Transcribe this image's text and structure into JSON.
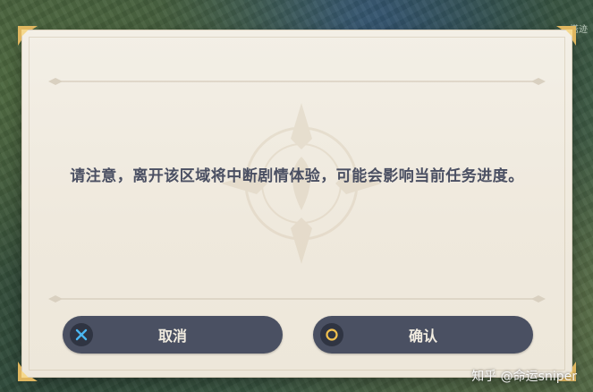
{
  "background": {
    "map_label": "塔迹"
  },
  "dialog": {
    "message": "请注意，离开该区域将中断剧情体验，可能会影响当前任务进度。"
  },
  "buttons": {
    "cancel": {
      "label": "取消",
      "icon": "x-icon",
      "icon_color": "#4ab6f0"
    },
    "confirm": {
      "label": "确认",
      "icon": "circle-icon",
      "icon_color": "#f2c14e"
    }
  },
  "watermark": {
    "text": "知乎 @命运sniper"
  },
  "colors": {
    "dialog_bg": "#f0ebe0",
    "button_bg": "#4a5062",
    "text": "#4a4f62",
    "corner_gold": "#e0b760"
  }
}
